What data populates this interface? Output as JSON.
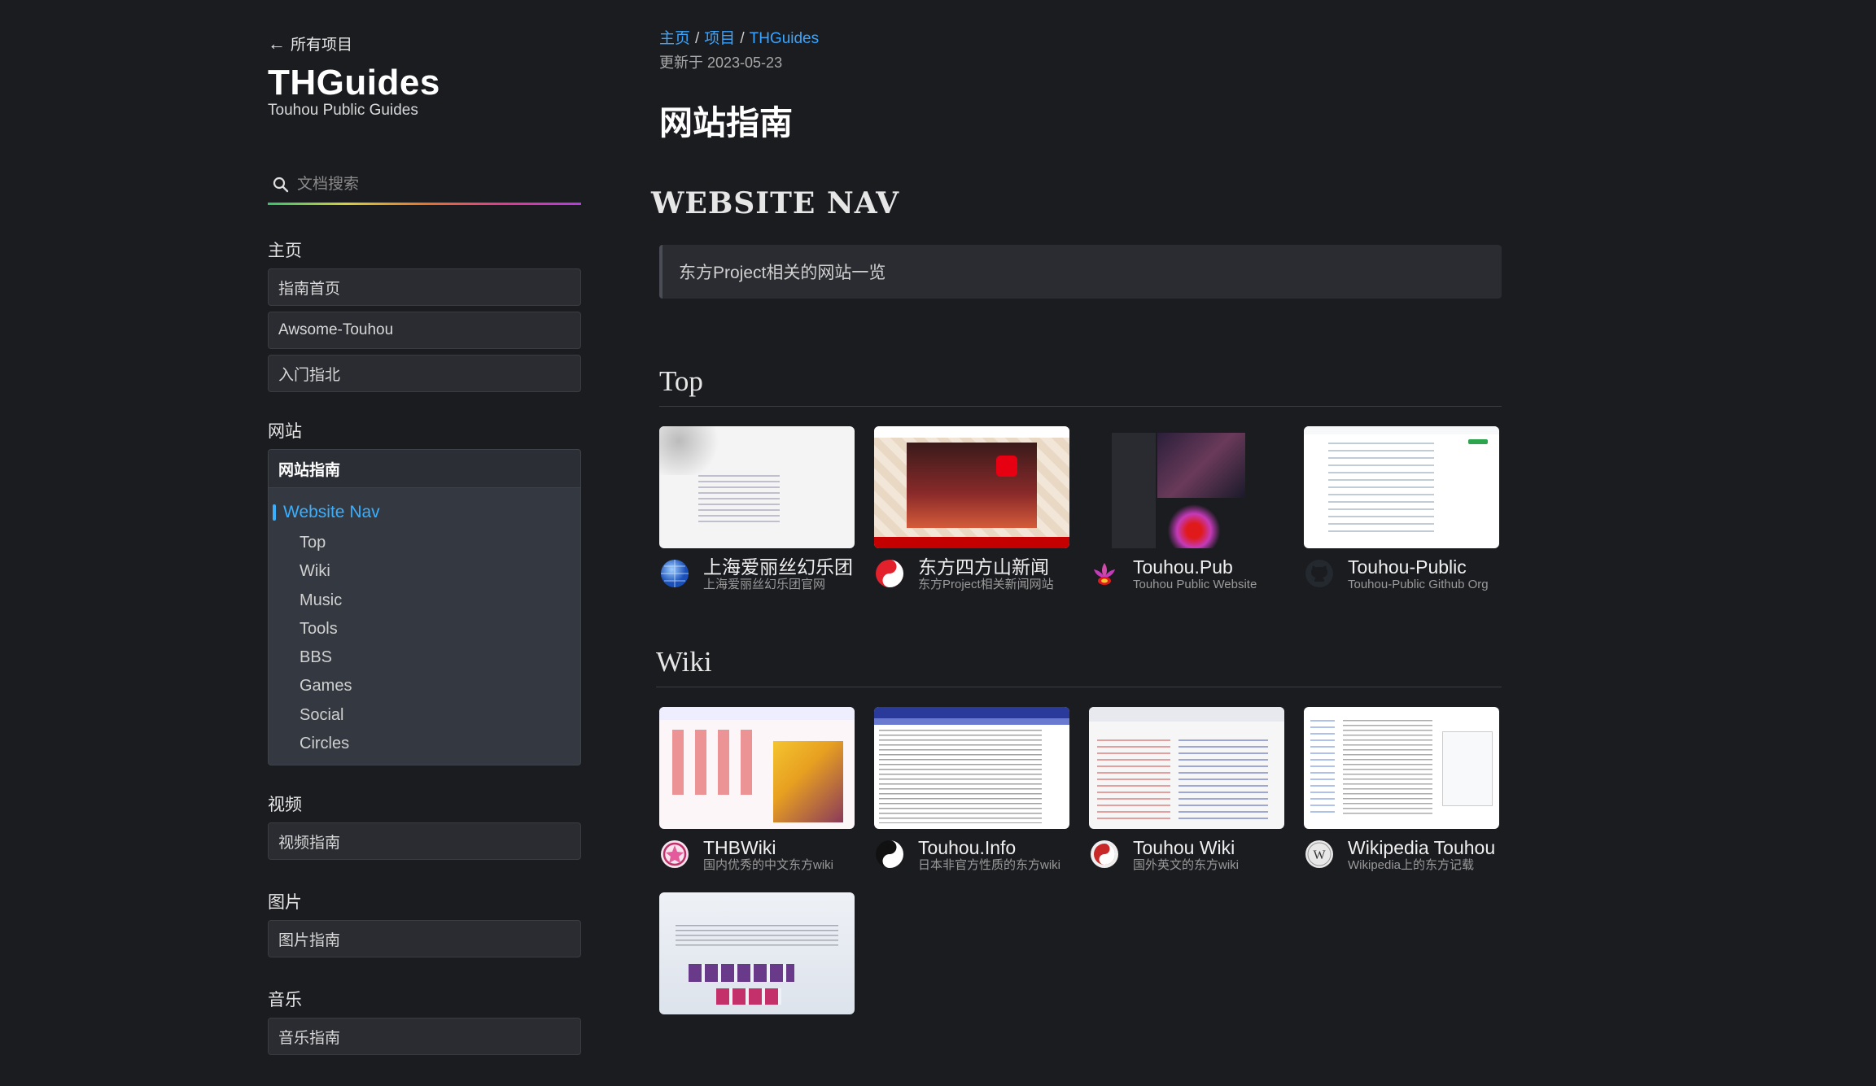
{
  "sidebar": {
    "back_label": "所有项目",
    "title": "THGuides",
    "subtitle": "Touhou Public Guides",
    "search_placeholder": "文档搜索",
    "sections": [
      {
        "title": "主页",
        "items": [
          "指南首页",
          "Awsome-Touhou",
          "入门指北"
        ]
      },
      {
        "title": "网站",
        "active": "网站指南",
        "toc_main": "Website Nav",
        "toc_sub": [
          "Top",
          "Wiki",
          "Music",
          "Tools",
          "BBS",
          "Games",
          "Social",
          "Circles"
        ]
      },
      {
        "title": "视频",
        "items": [
          "视频指南"
        ]
      },
      {
        "title": "图片",
        "items": [
          "图片指南"
        ]
      },
      {
        "title": "音乐",
        "items": [
          "音乐指南"
        ]
      }
    ]
  },
  "main": {
    "breadcrumb": [
      "主页",
      "项目",
      "THGuides"
    ],
    "updated": "更新于 2023-05-23",
    "title": "网站指南",
    "logo_text": "WEBSITE NAV",
    "quote": "东方Project相关的网站一览",
    "sections": [
      {
        "heading": "Top",
        "cards": [
          {
            "title": "上海爱丽丝幻乐团",
            "desc": "上海爱丽丝幻乐团官网",
            "icon": "globe-icon"
          },
          {
            "title": "东方四方山新闻",
            "desc": "东方Project相关新闻网站",
            "icon": "yinyang-red-icon"
          },
          {
            "title": "Touhou.Pub",
            "desc": "Touhou Public Website",
            "icon": "lotus-icon"
          },
          {
            "title": "Touhou-Public",
            "desc": "Touhou-Public Github Org",
            "icon": "github-icon"
          }
        ]
      },
      {
        "heading": "Wiki",
        "cards": [
          {
            "title": "THBWiki",
            "desc": "国内优秀的中文东方wiki",
            "icon": "thbwiki-icon"
          },
          {
            "title": "Touhou.Info",
            "desc": "日本非官方性质的东方wiki",
            "icon": "yinyang-icon"
          },
          {
            "title": "Touhou Wiki",
            "desc": "国外英文的东方wiki",
            "icon": "touhouwiki-icon"
          },
          {
            "title": "Wikipedia Touhou",
            "desc": "Wikipedia上的东方记载",
            "icon": "wikipedia-icon"
          },
          {
            "title": "",
            "desc": "",
            "icon": ""
          }
        ]
      }
    ]
  }
}
